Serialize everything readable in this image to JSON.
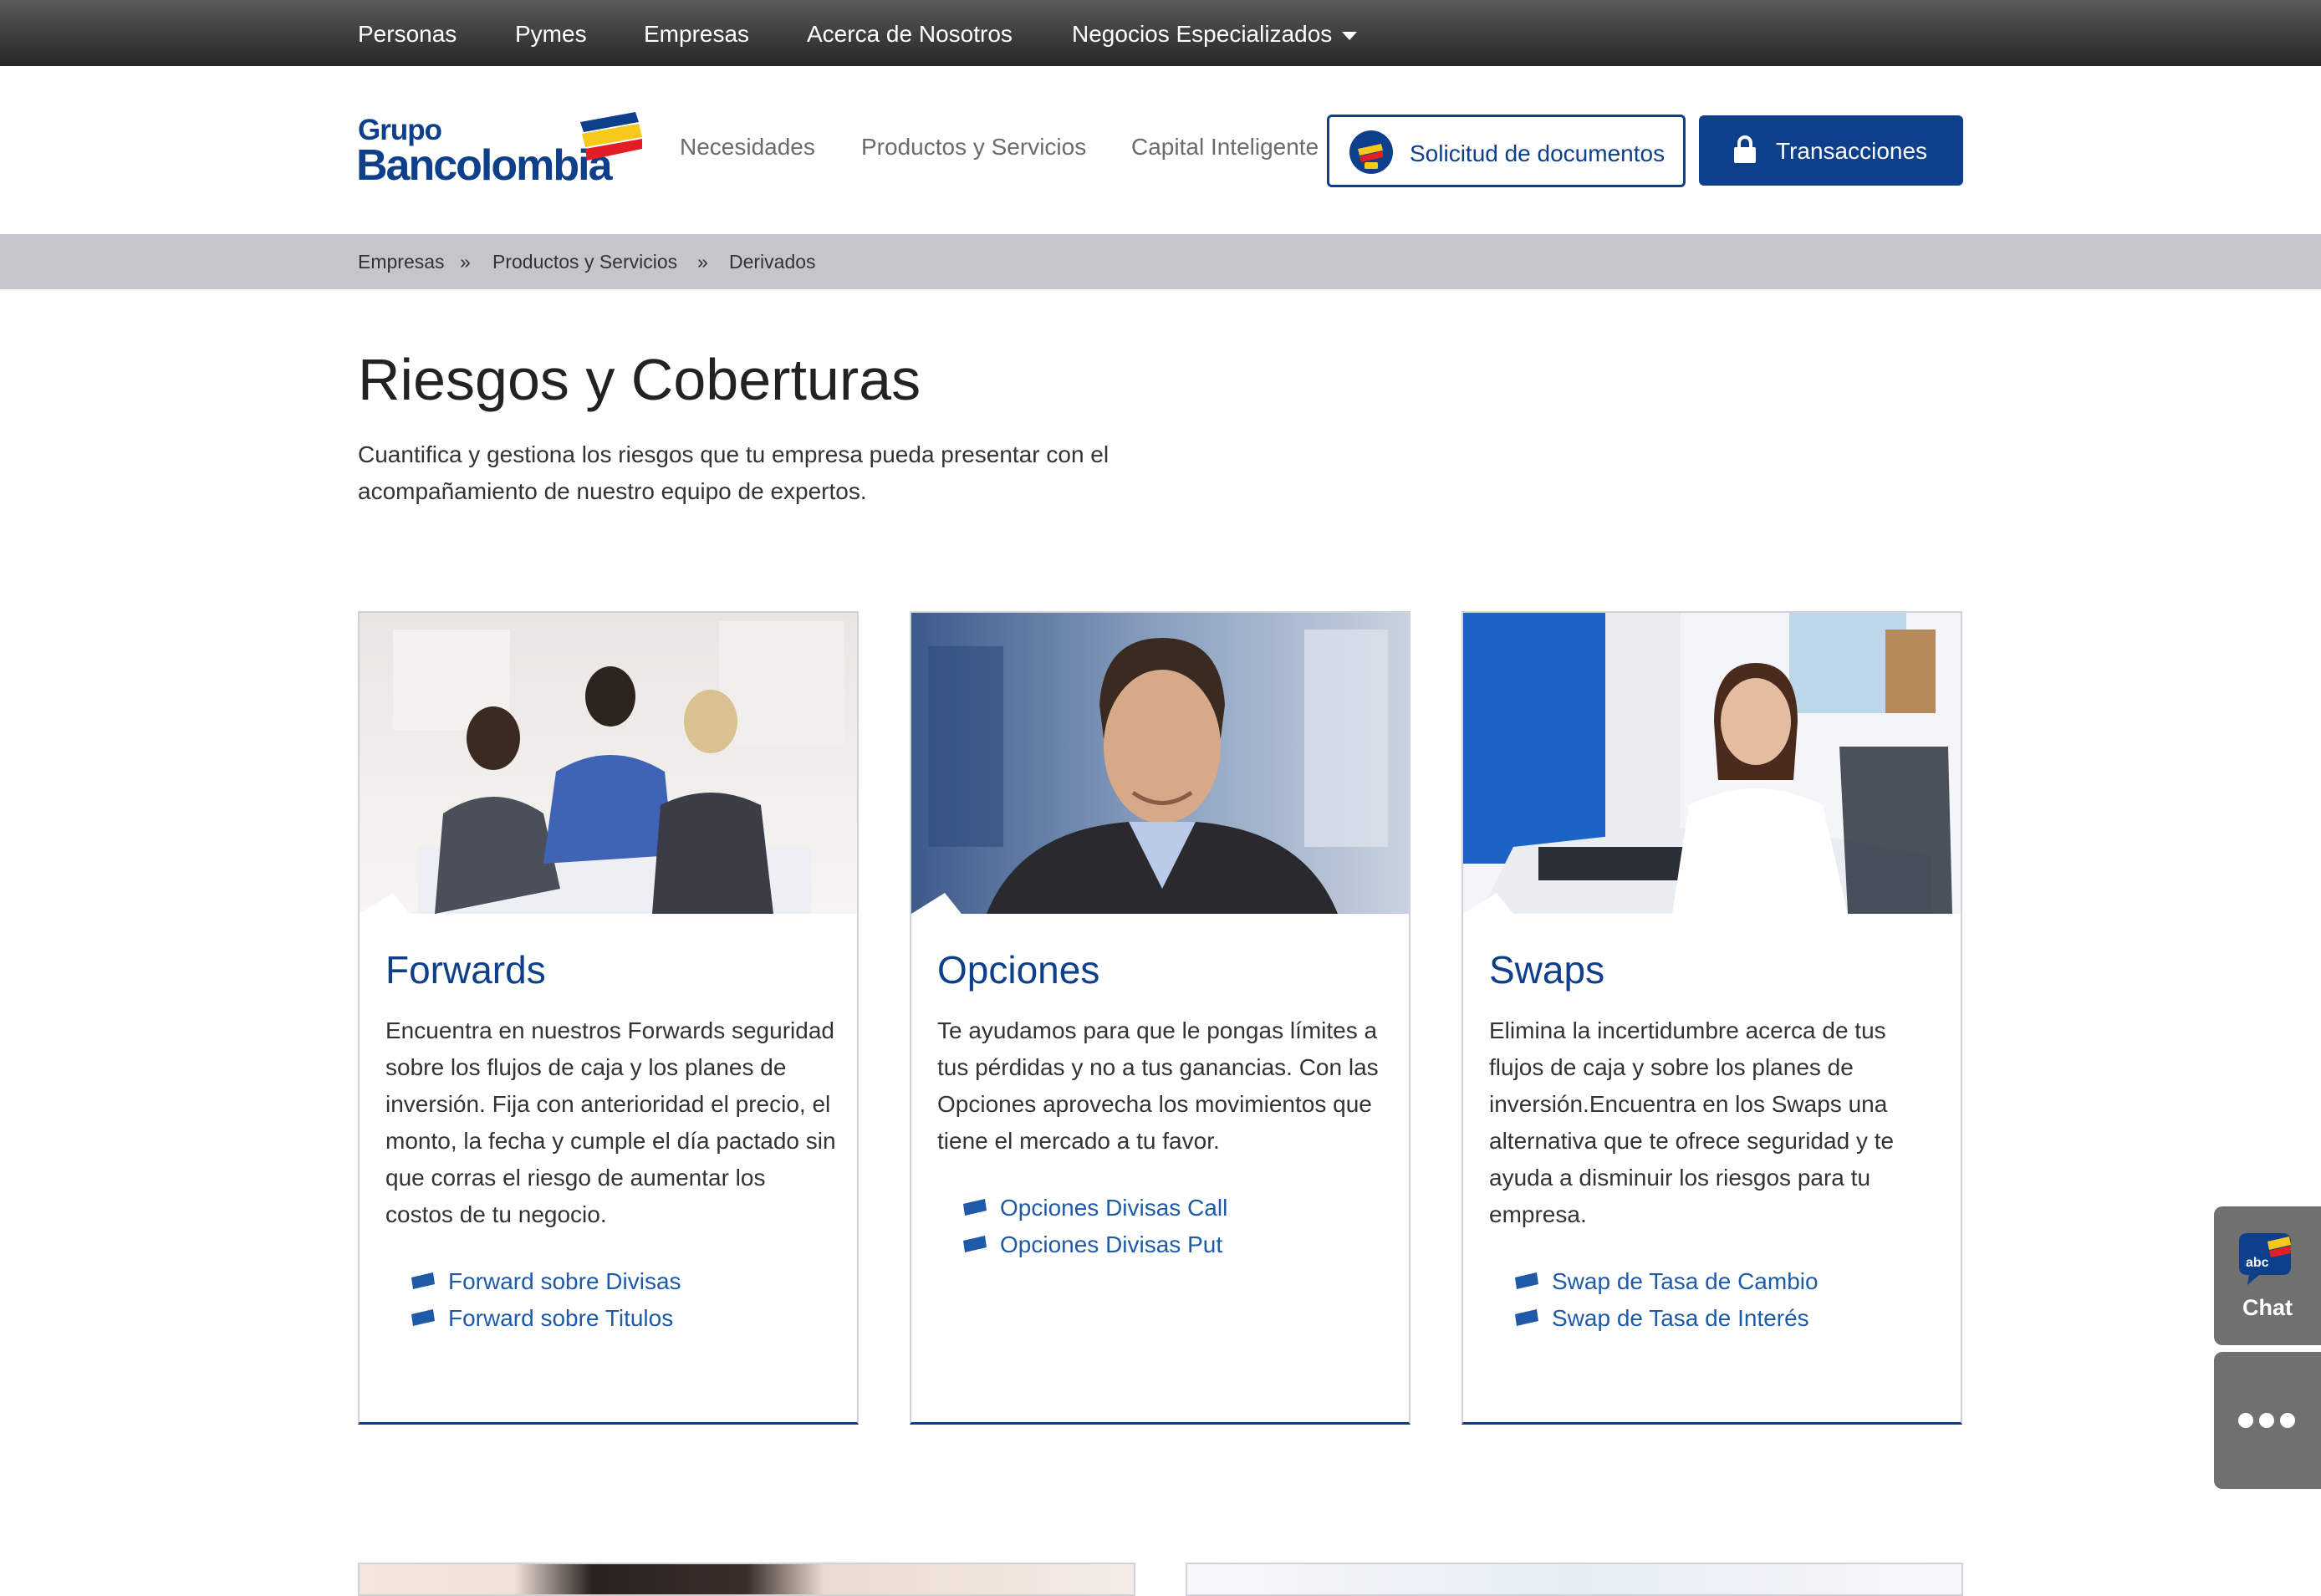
{
  "top_nav": {
    "items": [
      "Personas",
      "Pymes",
      "Empresas",
      "Acerca de Nosotros",
      "Negocios Especializados"
    ]
  },
  "logo": {
    "line1": "Grupo",
    "line2": "Bancolombia"
  },
  "main_nav": {
    "items": [
      "Necesidades",
      "Productos y Servicios",
      "Capital Inteligente"
    ]
  },
  "actions": {
    "documents_label": "Solicitud de documentos",
    "transactions_label": "Transacciones"
  },
  "breadcrumb": {
    "items": [
      "Empresas",
      "Productos y Servicios",
      "Derivados"
    ],
    "separator": "»"
  },
  "page": {
    "title": "Riesgos y Coberturas",
    "subtitle": "Cuantifica y gestiona los riesgos que tu empresa pueda presentar con el acompañamiento de nuestro equipo de expertos."
  },
  "cards": [
    {
      "title": "Forwards",
      "body": "Encuentra en nuestros Forwards seguridad sobre los flujos de caja y los planes de inversión. Fija con anterioridad el precio, el monto, la fecha y cumple el día pactado sin que corras el riesgo de aumentar los costos de tu negocio.",
      "links": [
        "Forward sobre Divisas",
        "Forward sobre Titulos"
      ]
    },
    {
      "title": "Opciones",
      "body": "Te ayudamos para que le pongas límites a tus pérdidas y no a tus ganancias. Con las Opciones aprovecha los movimientos que tiene el mercado a tu favor.",
      "links": [
        "Opciones Divisas Call",
        "Opciones Divisas Put"
      ]
    },
    {
      "title": "Swaps",
      "body": "Elimina la incertidumbre acerca de tus flujos de caja y sobre los planes de inversión.Encuentra en los Swaps una alternativa que te ofrece seguridad y te ayuda a disminuir los riesgos para tu empresa.",
      "links": [
        "Swap de Tasa de Cambio",
        "Swap de Tasa de Interés"
      ]
    }
  ],
  "chat": {
    "badge": "abc",
    "label": "Chat"
  },
  "colors": {
    "brand_blue": "#0d3f8a",
    "link_blue": "#1e5aa8",
    "flag_yellow": "#f8c81a",
    "flag_red": "#e31d25",
    "breadcrumb_bg": "#c4c6cb"
  },
  "icons": [
    "caret-down-icon",
    "document-request-icon",
    "lock-icon",
    "bullet-flag-icon",
    "chat-bubble-icon",
    "more-dots-icon"
  ]
}
